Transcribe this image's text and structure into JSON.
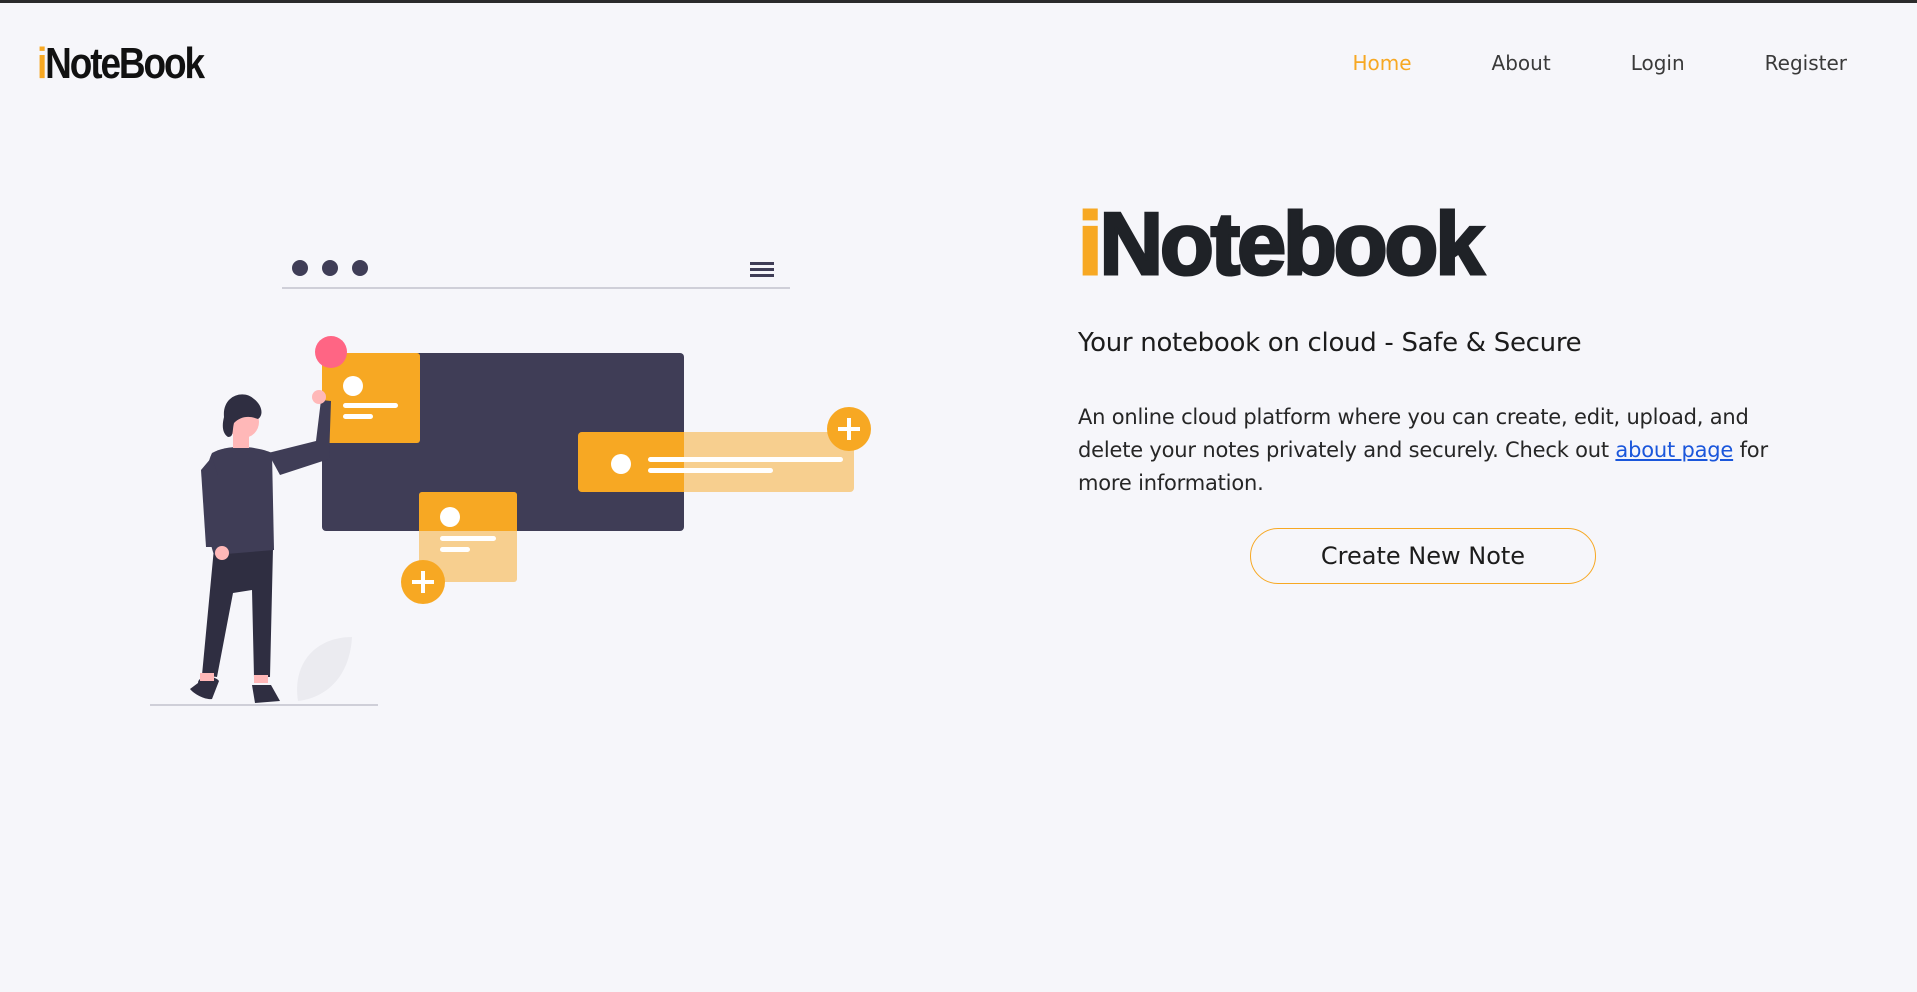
{
  "navbar": {
    "brand_accent": "i",
    "brand_rest": "NoteBook",
    "links": [
      {
        "label": "Home",
        "active": true
      },
      {
        "label": "About",
        "active": false
      },
      {
        "label": "Login",
        "active": false
      },
      {
        "label": "Register",
        "active": false
      }
    ]
  },
  "hero": {
    "title_accent": "i",
    "title_rest": "Notebook",
    "subtitle": "Your notebook on cloud - Safe & Secure",
    "description_before": "An online cloud platform where you can create, edit, upload, and delete your notes privately and securely. Check out ",
    "description_link": "about page",
    "description_after": " for more information.",
    "cta_label": "Create New Note"
  },
  "colors": {
    "accent": "#f7a823",
    "dark": "#3f3d56",
    "background": "#f6f6fa",
    "link": "#1a56db",
    "pin": "#ff6584"
  }
}
